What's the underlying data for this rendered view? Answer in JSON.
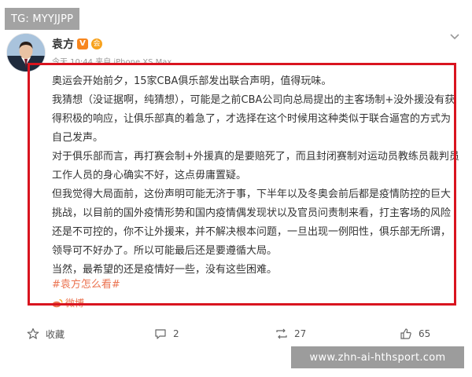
{
  "watermark_top": "TG: MYYJJPP",
  "watermark_bottom": "www.zhn-ai-hthsport.com",
  "author": {
    "name": "袁方",
    "v_badge": "V",
    "member_badge": "会"
  },
  "meta": "今天 10:44 来自 iPhone XS Max",
  "post": {
    "paragraphs": [
      "奥运会开始前夕，15家CBA俱乐部发出联合声明，值得玩味。",
      "我猜想（没证据啊，纯猜想），可能是之前CBA公司向总局提出的主客场制+没外援没有获得积极的响应，让俱乐部真的着急了，才选择在这个时候用这种类似于联合逼宫的方式为自己发声。",
      "对于俱乐部而言，再打赛会制+外援真的是要赔死了，而且封闭赛制对运动员教练员裁判员工作人员的身心确实不好，这点毋庸置疑。",
      "但我觉得大局面前，这份声明可能无济于事，下半年以及冬奥会前后都是疫情防控的巨大挑战，以目前的国外疫情形势和国内疫情偶发现状以及官员问责制来看，打主客场的风险还是不可控的，你不让外援来，并不解决根本问题，一旦出现一例阳性，俱乐部无所谓，领导可不好办了。所以可能最后还是要遵循大局。",
      "当然，最希望的还是疫情好一些，没有这些困难。"
    ],
    "tag": "#袁方怎么看#",
    "source": "微博"
  },
  "actions": {
    "favorite_label": "收藏",
    "comment_count": "2",
    "repost_count": "27",
    "like_count": "65"
  },
  "colors": {
    "highlight_border": "#d9141f",
    "tag": "#eb7350",
    "text": "#333333",
    "meta": "#999999"
  }
}
